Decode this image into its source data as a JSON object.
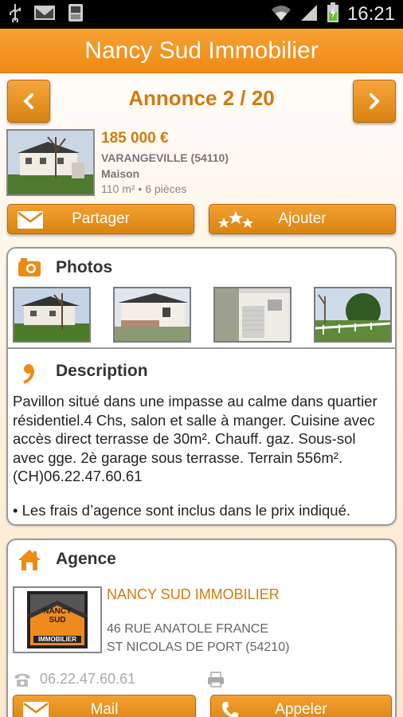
{
  "statusbar": {
    "time": "16:21"
  },
  "app": {
    "title": "Nancy Sud Immobilier"
  },
  "nav": {
    "prev_label": "<",
    "next_label": ">",
    "annonce": "Annonce 2 / 20"
  },
  "listing": {
    "price": "185 000 €",
    "city": "VARANGEVILLE (54110)",
    "type": "Maison",
    "size": "110 m² • 6 pièces"
  },
  "actions": {
    "share_label": "Partager",
    "add_label": "Ajouter"
  },
  "photos": {
    "title": "Photos"
  },
  "description": {
    "title": "Description",
    "text": "Pavillon situé dans une impasse au calme dans quartier résidentiel.4 Chs, salon et salle à manger. Cuisine avec accès direct terrasse de 30m². Chauff. gaz. Sous-sol avec gge. 2è garage sous terrasse. Terrain 556m². (CH)06.22.47.60.61",
    "fees": "• Les frais d’agence sont inclus dans le prix indiqué."
  },
  "agence": {
    "title": "Agence",
    "logo_text": [
      "NANCY",
      "SUD",
      "IMMOBILIER"
    ],
    "name": "NANCY SUD IMMOBILIER",
    "address1": "46 RUE ANATOLE FRANCE",
    "address2": "ST NICOLAS DE PORT (54210)",
    "phone": "06.22.47.60.61",
    "mail_label": "Mail",
    "call_label": "Appeler"
  },
  "colors": {
    "accent": "#ef8a14",
    "accent_text": "#d27a10"
  }
}
